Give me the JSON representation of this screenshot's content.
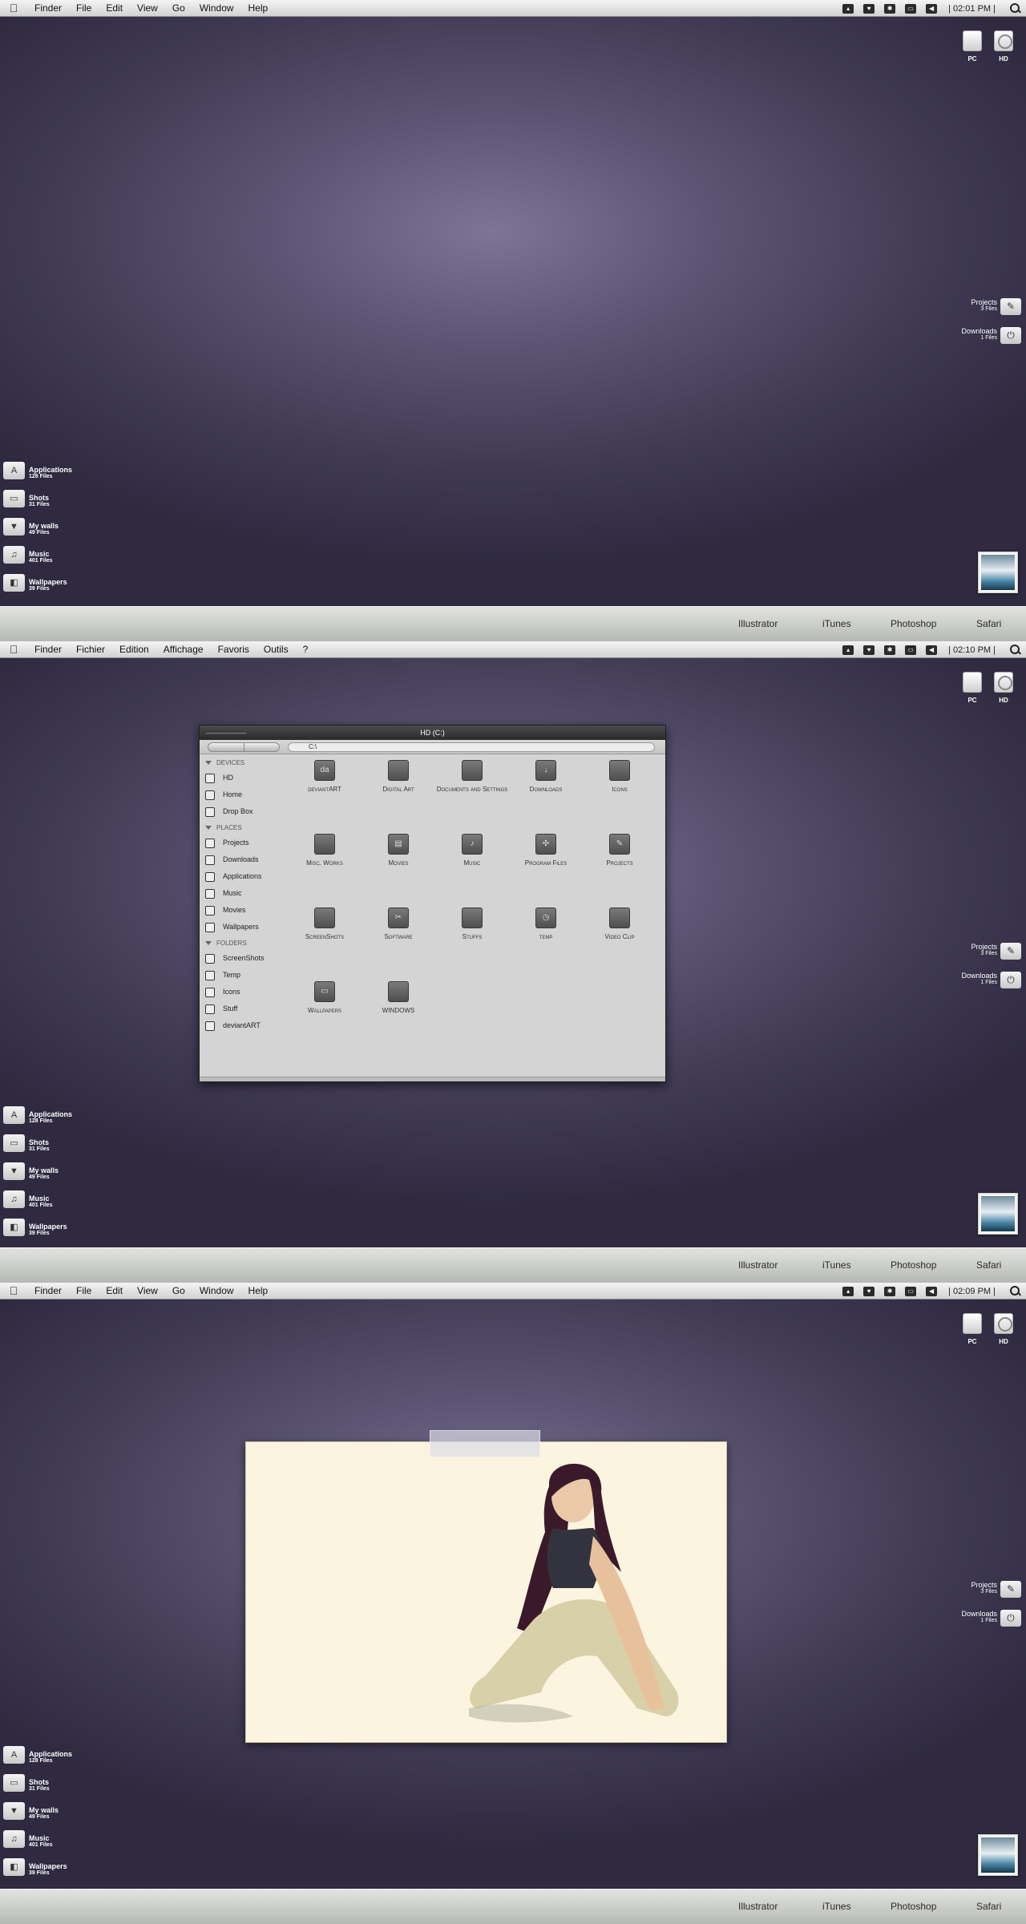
{
  "menubar_en": {
    "app": "Finder",
    "items": [
      "File",
      "Edit",
      "View",
      "Go",
      "Window",
      "Help"
    ]
  },
  "menubar_fr": {
    "app": "Finder",
    "items": [
      "Fichier",
      "Edition",
      "Affichage",
      "Favoris",
      "Outils",
      "?"
    ]
  },
  "clocks": [
    "| 02:01 PM |",
    "| 02:10 PM |",
    "| 02:09 PM |"
  ],
  "drives": [
    {
      "label": "PC",
      "icon": "drive-icon"
    },
    {
      "label": "HD",
      "icon": "hard-disk-icon"
    }
  ],
  "right_stacks": [
    {
      "name": "Projects",
      "count": "3 Files",
      "icon": "pencil-icon"
    },
    {
      "name": "Downloads",
      "count": "1 Files",
      "icon": "download-icon"
    }
  ],
  "left_stacks": [
    {
      "name": "Applications",
      "count": "128 Files",
      "icon": "applications-icon"
    },
    {
      "name": "Shots",
      "count": "31 Files",
      "icon": "monitor-icon"
    },
    {
      "name": "My walls",
      "count": "49 Files",
      "icon": "walls-icon"
    },
    {
      "name": "Music",
      "count": "401 Files",
      "icon": "music-icon"
    },
    {
      "name": "Wallpapers",
      "count": "39 Files",
      "icon": "wallpapers-icon"
    }
  ],
  "dock": {
    "items": [
      "Illustrator",
      "iTunes",
      "Photoshop",
      "Safari"
    ]
  },
  "finder_window": {
    "title": "HD (C:)",
    "path": "C:\\",
    "sections": [
      {
        "header": "DEVICES",
        "items": [
          "HD",
          "Home",
          "Drop Box"
        ]
      },
      {
        "header": "PLACES",
        "items": [
          "Projects",
          "Downloads",
          "Applications",
          "Music",
          "Movies",
          "Wallpapers"
        ]
      },
      {
        "header": "FOLDERS",
        "items": [
          "ScreenShots",
          "Temp",
          "Icons",
          "Stuff",
          "deviantART"
        ]
      }
    ],
    "folders": [
      "deviantART",
      "Digital Art",
      "Documents and Settings",
      "Downloads",
      "Icons",
      "Misc. Works",
      "Movies",
      "Music",
      "Program Files",
      "Projects",
      "ScreenShots",
      "Software",
      "Stuffs",
      "temp",
      "Video Clip",
      "Wallpapers",
      "WINDOWS"
    ]
  }
}
